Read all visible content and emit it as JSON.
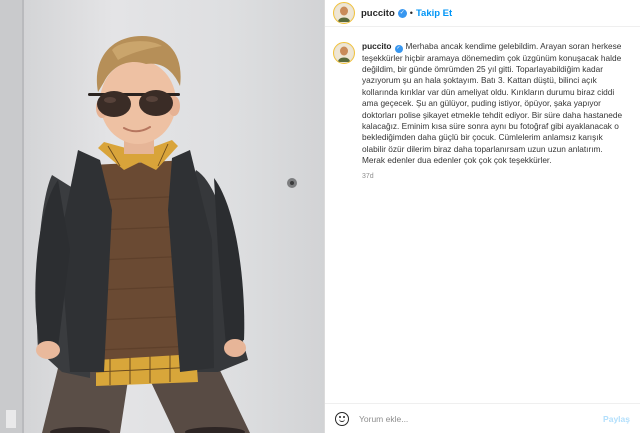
{
  "post": {
    "username": "puccito",
    "follow_label": "Takip Et",
    "separator": "•",
    "caption": "Merhaba ancak kendime gelebildim. Arayan soran herkese teşekkürler hiçbir aramaya dönemedim çok üzgünüm konuşacak halde değildim, bir günde ömrümden 25 yıl gitti. Toparlayabildiğim kadar yazıyorum şu an hala şoktayım. Batı 3. Kattan düştü, bilinci açık kollarında kırıklar var dün ameliyat oldu. Kırıkların durumu biraz ciddi ama geçecek. Şu an gülüyor, puding istiyor, öpüyor, şaka yapıyor doktorları polise şikayet etmekle tehdit ediyor. Bir süre daha hastanede kalacağız. Eminim kısa süre sonra aynı bu fotoğraf gibi ayaklanacak o beklediğimden daha güçlü bir çocuk. Cümlelerim anlamsız karışık olabilir özür dilerim biraz daha toparlanırsam uzun uzun anlatırım. Merak edenler dua edenler çok çok çok teşekkürler.",
    "age": "37d"
  },
  "comment_box": {
    "placeholder": "Yorum ekle...",
    "post_label": "Paylaş"
  },
  "icons": {
    "verified": "verified-badge-icon",
    "emoji": "smiley-face-icon"
  },
  "colors": {
    "accent_blue": "#0095f6",
    "verified_blue": "#3897f0",
    "post_disabled": "#b2dffc",
    "story_ring": "#f2c23a"
  }
}
